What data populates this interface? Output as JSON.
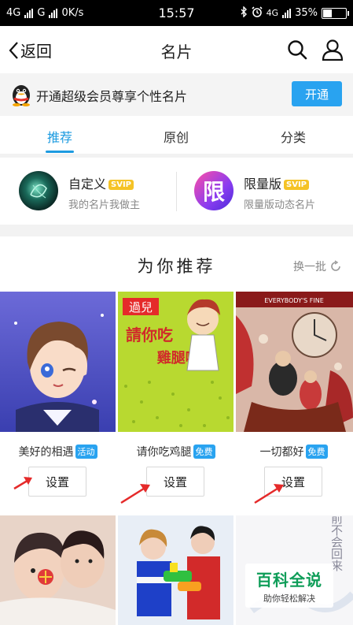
{
  "status_bar": {
    "net1": "4G",
    "net2": "G",
    "speed": "0K/s",
    "time": "15:57",
    "net3": "4G",
    "battery": "35%",
    "battery_level": 0.35
  },
  "nav": {
    "back_label": "返回",
    "title": "名片"
  },
  "banner": {
    "text": "开通超级会员尊享个性名片",
    "button": "开通"
  },
  "tabs": [
    {
      "label": "推荐",
      "active": true
    },
    {
      "label": "原创",
      "active": false
    },
    {
      "label": "分类",
      "active": false
    }
  ],
  "categories": [
    {
      "title": "自定义",
      "badge": "SVIP",
      "subtitle": "我的名片我做主"
    },
    {
      "title": "限量版",
      "badge": "SVIP",
      "subtitle": "限量版动态名片",
      "icon_char": "限"
    }
  ],
  "recommend": {
    "title": "为你推荐",
    "refresh": "换一批"
  },
  "cards": [
    {
      "name": "美好的相遇",
      "badge": "活动",
      "button": "设置"
    },
    {
      "name": "请你吃鸡腿",
      "badge": "免费",
      "button": "设置",
      "image_text_top": "過兒",
      "image_text_mid": "請你吃",
      "image_text_bot": "雞腿啦!!"
    },
    {
      "name": "一切都好",
      "badge": "免费",
      "button": "设置",
      "image_text_top": "EVERYBODY'S FINE"
    }
  ],
  "row2_text": "从前不会回来",
  "watermark": {
    "title": "百科全说",
    "subtitle": "助你轻松解决"
  },
  "colors": {
    "accent": "#29a3f0",
    "svip": "#f5c326",
    "watermark_green": "#0e9d58"
  }
}
